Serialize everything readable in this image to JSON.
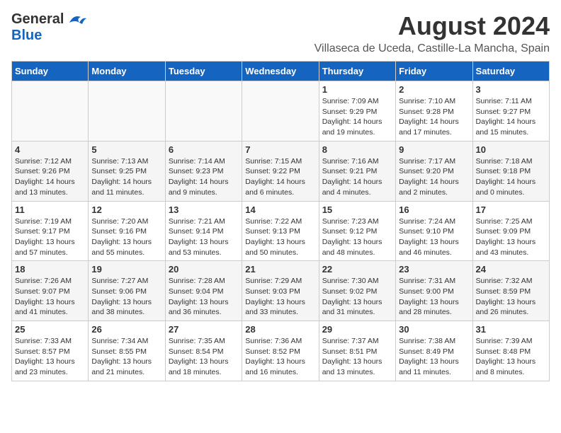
{
  "header": {
    "logo_general": "General",
    "logo_blue": "Blue",
    "month_title": "August 2024",
    "location": "Villaseca de Uceda, Castille-La Mancha, Spain"
  },
  "days_of_week": [
    "Sunday",
    "Monday",
    "Tuesday",
    "Wednesday",
    "Thursday",
    "Friday",
    "Saturday"
  ],
  "weeks": [
    [
      {
        "day": "",
        "info": ""
      },
      {
        "day": "",
        "info": ""
      },
      {
        "day": "",
        "info": ""
      },
      {
        "day": "",
        "info": ""
      },
      {
        "day": "1",
        "info": "Sunrise: 7:09 AM\nSunset: 9:29 PM\nDaylight: 14 hours and 19 minutes."
      },
      {
        "day": "2",
        "info": "Sunrise: 7:10 AM\nSunset: 9:28 PM\nDaylight: 14 hours and 17 minutes."
      },
      {
        "day": "3",
        "info": "Sunrise: 7:11 AM\nSunset: 9:27 PM\nDaylight: 14 hours and 15 minutes."
      }
    ],
    [
      {
        "day": "4",
        "info": "Sunrise: 7:12 AM\nSunset: 9:26 PM\nDaylight: 14 hours and 13 minutes."
      },
      {
        "day": "5",
        "info": "Sunrise: 7:13 AM\nSunset: 9:25 PM\nDaylight: 14 hours and 11 minutes."
      },
      {
        "day": "6",
        "info": "Sunrise: 7:14 AM\nSunset: 9:23 PM\nDaylight: 14 hours and 9 minutes."
      },
      {
        "day": "7",
        "info": "Sunrise: 7:15 AM\nSunset: 9:22 PM\nDaylight: 14 hours and 6 minutes."
      },
      {
        "day": "8",
        "info": "Sunrise: 7:16 AM\nSunset: 9:21 PM\nDaylight: 14 hours and 4 minutes."
      },
      {
        "day": "9",
        "info": "Sunrise: 7:17 AM\nSunset: 9:20 PM\nDaylight: 14 hours and 2 minutes."
      },
      {
        "day": "10",
        "info": "Sunrise: 7:18 AM\nSunset: 9:18 PM\nDaylight: 14 hours and 0 minutes."
      }
    ],
    [
      {
        "day": "11",
        "info": "Sunrise: 7:19 AM\nSunset: 9:17 PM\nDaylight: 13 hours and 57 minutes."
      },
      {
        "day": "12",
        "info": "Sunrise: 7:20 AM\nSunset: 9:16 PM\nDaylight: 13 hours and 55 minutes."
      },
      {
        "day": "13",
        "info": "Sunrise: 7:21 AM\nSunset: 9:14 PM\nDaylight: 13 hours and 53 minutes."
      },
      {
        "day": "14",
        "info": "Sunrise: 7:22 AM\nSunset: 9:13 PM\nDaylight: 13 hours and 50 minutes."
      },
      {
        "day": "15",
        "info": "Sunrise: 7:23 AM\nSunset: 9:12 PM\nDaylight: 13 hours and 48 minutes."
      },
      {
        "day": "16",
        "info": "Sunrise: 7:24 AM\nSunset: 9:10 PM\nDaylight: 13 hours and 46 minutes."
      },
      {
        "day": "17",
        "info": "Sunrise: 7:25 AM\nSunset: 9:09 PM\nDaylight: 13 hours and 43 minutes."
      }
    ],
    [
      {
        "day": "18",
        "info": "Sunrise: 7:26 AM\nSunset: 9:07 PM\nDaylight: 13 hours and 41 minutes."
      },
      {
        "day": "19",
        "info": "Sunrise: 7:27 AM\nSunset: 9:06 PM\nDaylight: 13 hours and 38 minutes."
      },
      {
        "day": "20",
        "info": "Sunrise: 7:28 AM\nSunset: 9:04 PM\nDaylight: 13 hours and 36 minutes."
      },
      {
        "day": "21",
        "info": "Sunrise: 7:29 AM\nSunset: 9:03 PM\nDaylight: 13 hours and 33 minutes."
      },
      {
        "day": "22",
        "info": "Sunrise: 7:30 AM\nSunset: 9:02 PM\nDaylight: 13 hours and 31 minutes."
      },
      {
        "day": "23",
        "info": "Sunrise: 7:31 AM\nSunset: 9:00 PM\nDaylight: 13 hours and 28 minutes."
      },
      {
        "day": "24",
        "info": "Sunrise: 7:32 AM\nSunset: 8:59 PM\nDaylight: 13 hours and 26 minutes."
      }
    ],
    [
      {
        "day": "25",
        "info": "Sunrise: 7:33 AM\nSunset: 8:57 PM\nDaylight: 13 hours and 23 minutes."
      },
      {
        "day": "26",
        "info": "Sunrise: 7:34 AM\nSunset: 8:55 PM\nDaylight: 13 hours and 21 minutes."
      },
      {
        "day": "27",
        "info": "Sunrise: 7:35 AM\nSunset: 8:54 PM\nDaylight: 13 hours and 18 minutes."
      },
      {
        "day": "28",
        "info": "Sunrise: 7:36 AM\nSunset: 8:52 PM\nDaylight: 13 hours and 16 minutes."
      },
      {
        "day": "29",
        "info": "Sunrise: 7:37 AM\nSunset: 8:51 PM\nDaylight: 13 hours and 13 minutes."
      },
      {
        "day": "30",
        "info": "Sunrise: 7:38 AM\nSunset: 8:49 PM\nDaylight: 13 hours and 11 minutes."
      },
      {
        "day": "31",
        "info": "Sunrise: 7:39 AM\nSunset: 8:48 PM\nDaylight: 13 hours and 8 minutes."
      }
    ]
  ]
}
